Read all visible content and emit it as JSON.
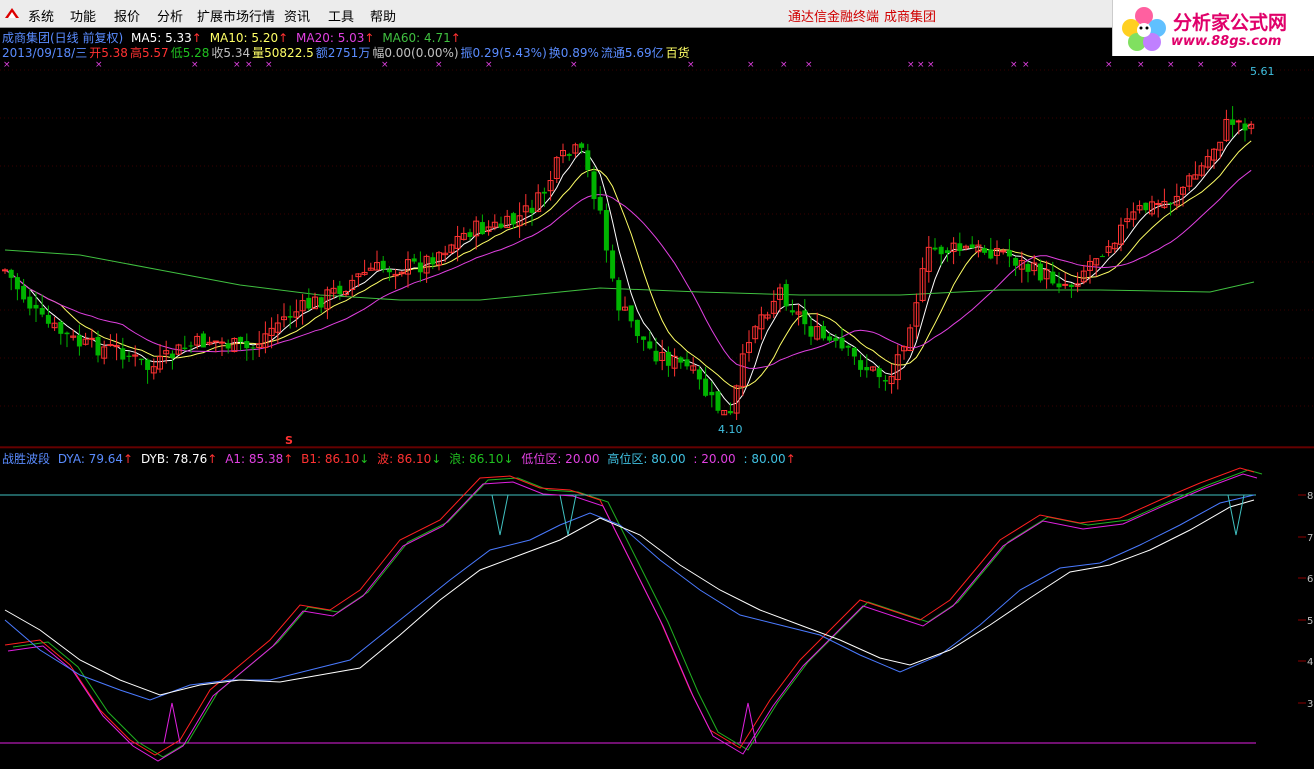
{
  "menu": {
    "items": [
      "系统",
      "功能",
      "报价",
      "分析",
      "扩展市场行情",
      "资讯",
      "工具",
      "帮助"
    ],
    "right_items": [
      "通达信金融终端",
      "成商集团"
    ]
  },
  "brand": {
    "name": "分析家公式网",
    "url": "www.88gs.com"
  },
  "header": {
    "title": "成商集团(日线 前复权)",
    "ma5": "MA5: 5.33",
    "ma10": "MA10: 5.20",
    "ma20": "MA20: 5.03",
    "ma60": "MA60: 4.71",
    "date": "2013/09/18/三",
    "open": "开5.38",
    "high": "高5.57",
    "low": "低5.28",
    "close": "收5.34",
    "volume": "量50822.5",
    "amount": "额2751万",
    "change": "幅0.00(0.00%)",
    "amplitude": "振0.29(5.43%)",
    "turnover": "换0.89%",
    "float": "流通5.69亿",
    "sector": "百货"
  },
  "price_chart": {
    "high_label": "5.61",
    "low_label": "4.10"
  },
  "indicator": {
    "name": "战胜波段",
    "dya": "DYA: 79.64",
    "dyb": "DYB: 78.76",
    "a1": "A1: 85.38",
    "b1": "B1: 86.10",
    "bo": "波: 86.10",
    "lang": "浪: 86.10",
    "low_zone": "低位区: 20.00",
    "high_zone": "高位区: 80.00",
    "v20": ": 20.00",
    "v80": ": 80.00",
    "signal": "S"
  },
  "right_axis_ticks": [
    "8",
    "7",
    "6",
    "5",
    "4",
    "3"
  ],
  "colors": {
    "up": "#ff3232",
    "down": "#00b400",
    "ma5": "#ffffff",
    "ma10": "#ffff66",
    "ma20": "#e040e0",
    "ma60": "#40c040",
    "dya": "#4a7aff",
    "dyb": "#ffffff",
    "a1": "#ff2020",
    "b1": "#20b020",
    "zone": "#e020e0",
    "hi": "#40c0c0"
  }
}
